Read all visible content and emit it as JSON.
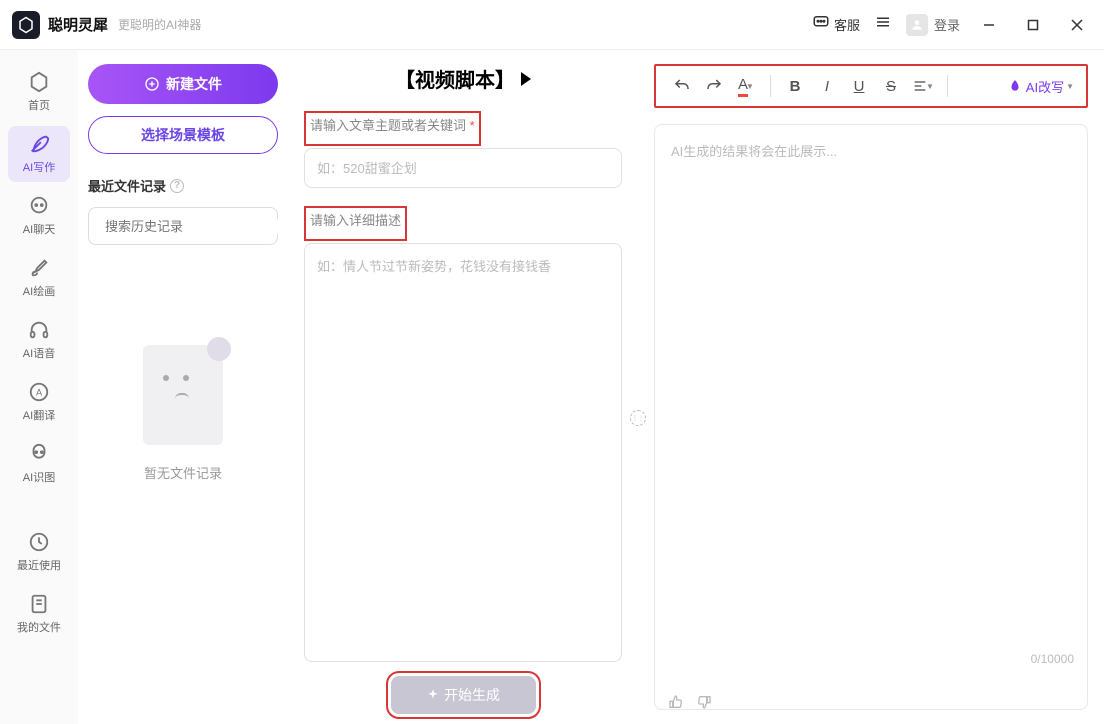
{
  "titlebar": {
    "app_name": "聪明灵犀",
    "tagline": "更聪明的AI神器",
    "customer_service": "客服",
    "login": "登录"
  },
  "sidebar": {
    "items": [
      {
        "label": "首页",
        "icon": "hexagon"
      },
      {
        "label": "AI写作",
        "icon": "feather",
        "active": true
      },
      {
        "label": "AI聊天",
        "icon": "chat"
      },
      {
        "label": "AI绘画",
        "icon": "brush"
      },
      {
        "label": "AI语音",
        "icon": "headphones"
      },
      {
        "label": "AI翻译",
        "icon": "translate"
      },
      {
        "label": "AI识图",
        "icon": "image"
      }
    ],
    "bottom": [
      {
        "label": "最近使用",
        "icon": "clock"
      },
      {
        "label": "我的文件",
        "icon": "file"
      }
    ]
  },
  "files_col": {
    "new_file": "新建文件",
    "scene_template": "选择场景模板",
    "recent_header": "最近文件记录",
    "search_placeholder": "搜索历史记录",
    "empty_label": "暂无文件记录"
  },
  "input_col": {
    "title": "【视频脚本】",
    "label_topic": "请输入文章主题或者关键词",
    "placeholder_topic": "如：520甜蜜企划",
    "label_detail": "请输入详细描述",
    "placeholder_detail": "如：情人节过节新姿势，花钱没有接钱香",
    "generate_btn": "开始生成"
  },
  "output_col": {
    "placeholder": "AI生成的结果将会在此展示...",
    "ai_rewrite": "AI改写",
    "char_count": "0/10000",
    "toolbar": {
      "font": "A",
      "bold": "B",
      "italic": "I",
      "underline": "U",
      "strike": "S"
    }
  }
}
